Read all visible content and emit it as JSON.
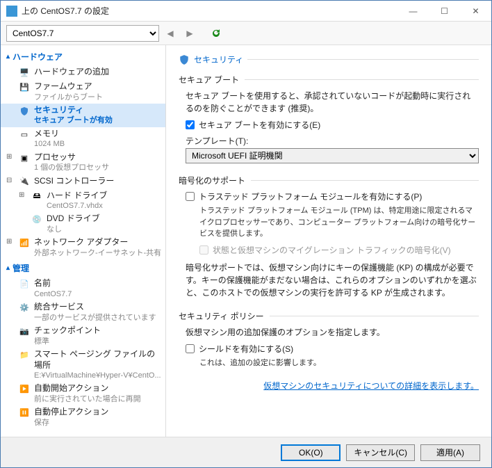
{
  "window": {
    "title": "上の CentOS7.7 の設定",
    "min": "—",
    "max": "☐",
    "close": "✕"
  },
  "toolbar": {
    "vm_selected": "CentOS7.7",
    "prev": "◀",
    "next": "▶",
    "refresh": "↻"
  },
  "sidebar": {
    "cat_hw": "ハードウェア",
    "cat_mgmt": "管理",
    "items": [
      {
        "label": "ハードウェアの追加",
        "sub": ""
      },
      {
        "label": "ファームウェア",
        "sub": "ファイルからブート"
      },
      {
        "label": "セキュリティ",
        "sub": "セキュア ブートが有効"
      },
      {
        "label": "メモリ",
        "sub": "1024 MB"
      },
      {
        "label": "プロセッサ",
        "sub": "1 個の仮想プロセッサ"
      },
      {
        "label": "SCSI コントローラー",
        "sub": ""
      },
      {
        "label": "ハード ドライブ",
        "sub": "CentOS7.7.vhdx"
      },
      {
        "label": "DVD ドライブ",
        "sub": "なし"
      },
      {
        "label": "ネットワーク アダプター",
        "sub": "外部ネットワーク-イーサネット-共有"
      },
      {
        "label": "名前",
        "sub": "CentOS7.7"
      },
      {
        "label": "統合サービス",
        "sub": "一部のサービスが提供されています"
      },
      {
        "label": "チェックポイント",
        "sub": "標準"
      },
      {
        "label": "スマート ページング ファイルの場所",
        "sub": "E:¥VirtualMachine¥Hyper-V¥CentO..."
      },
      {
        "label": "自動開始アクション",
        "sub": "前に実行されていた場合に再開"
      },
      {
        "label": "自動停止アクション",
        "sub": "保存"
      }
    ]
  },
  "content": {
    "header": "セキュリティ",
    "secure_boot": {
      "legend": "セキュア ブート",
      "desc": "セキュア ブートを使用すると、承認されていないコードが起動時に実行されるのを防ぐことができます (推奨)。",
      "enable": "セキュア ブートを有効にする(E)",
      "template_label": "テンプレート(T):",
      "template_value": "Microsoft UEFI 証明機関"
    },
    "encryption": {
      "legend": "暗号化のサポート",
      "tpm": "トラステッド プラットフォーム モジュールを有効にする(P)",
      "tpm_desc": "トラステッド プラットフォーム モジュール (TPM) は、特定用途に限定されるマイクロプロセッサーであり、コンピューター プラットフォーム向けの暗号化サービスを提供します。",
      "migrate": "状態と仮想マシンのマイグレーション トラフィックの暗号化(V)",
      "kp_desc": "暗号化サポートでは、仮想マシン向けにキーの保護機能 (KP) の構成が必要です。キーの保護機能がまだない場合は、これらのオプションのいずれかを選ぶと、このホストでの仮想マシンの実行を許可する KP が生成されます。"
    },
    "policy": {
      "legend": "セキュリティ ポリシー",
      "desc": "仮想マシン用の追加保護のオプションを指定します。",
      "shield": "シールドを有効にする(S)",
      "shield_desc": "これは、追加の設定に影響します。"
    },
    "link": "仮想マシンのセキュリティについての詳細を表示します。"
  },
  "footer": {
    "ok": "OK(O)",
    "cancel": "キャンセル(C)",
    "apply": "適用(A)"
  }
}
